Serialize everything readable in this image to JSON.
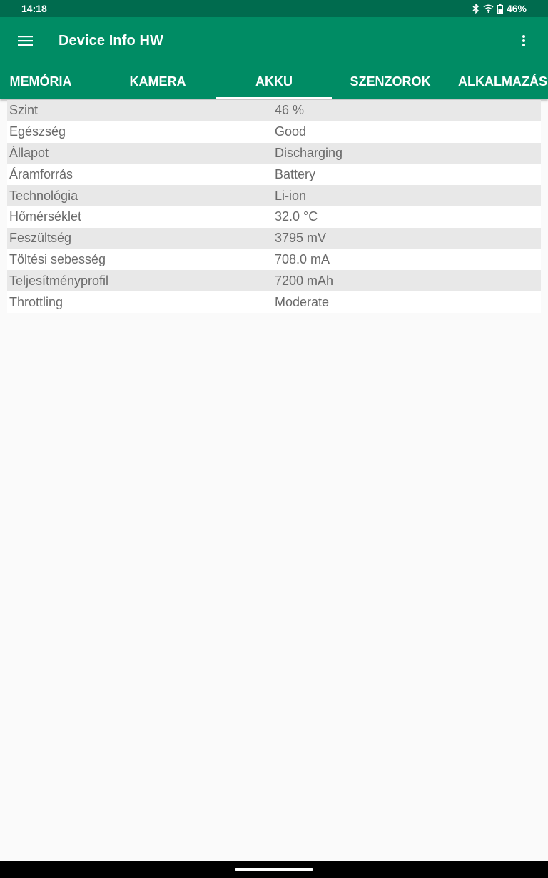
{
  "status_bar": {
    "time": "14:18",
    "battery_percent": "46%"
  },
  "app_bar": {
    "title": "Device Info HW",
    "menu_icon": "hamburger-menu-icon",
    "overflow_icon": "more-vert-icon"
  },
  "tabs": [
    {
      "label": "MEMÓRIA",
      "active": false
    },
    {
      "label": "KAMERA",
      "active": false
    },
    {
      "label": "AKKU",
      "active": true
    },
    {
      "label": "SZENZOROK",
      "active": false
    },
    {
      "label": "ALKALMAZÁS",
      "active": false
    }
  ],
  "battery_info": [
    {
      "label": "Szint",
      "value": "46 %"
    },
    {
      "label": "Egészség",
      "value": "Good"
    },
    {
      "label": "Állapot",
      "value": "Discharging"
    },
    {
      "label": "Áramforrás",
      "value": "Battery"
    },
    {
      "label": "Technológia",
      "value": "Li-ion"
    },
    {
      "label": "Hőmérséklet",
      "value": "32.0 °C"
    },
    {
      "label": "Feszültség",
      "value": "3795 mV"
    },
    {
      "label": "Töltési sebesség",
      "value": "708.0 mA"
    },
    {
      "label": "Teljesítményprofil",
      "value": "7200 mAh"
    },
    {
      "label": "Throttling",
      "value": "Moderate"
    }
  ],
  "colors": {
    "primary": "#008c64",
    "primary_dark": "#006b4e",
    "row_stripe": "#e8e8e8",
    "text": "#6a6a6a"
  }
}
